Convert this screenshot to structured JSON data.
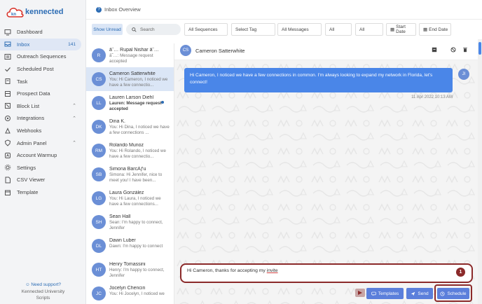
{
  "brand": {
    "name": "kennected",
    "logo_letters": "kn"
  },
  "sidebar": {
    "items": [
      {
        "label": "Dashboard",
        "icon": "monitor-icon"
      },
      {
        "label": "Inbox",
        "icon": "inbox-icon",
        "badge": "141",
        "active": true
      },
      {
        "label": "Outreach Sequences",
        "icon": "sequence-icon"
      },
      {
        "label": "Scheduled Post",
        "icon": "check-icon"
      },
      {
        "label": "Task",
        "icon": "task-icon"
      },
      {
        "label": "Prospect Data",
        "icon": "data-icon"
      },
      {
        "label": "Block List",
        "icon": "block-icon",
        "expandable": true
      },
      {
        "label": "Integrations",
        "icon": "integrations-icon",
        "expandable": true
      },
      {
        "label": "Webhooks",
        "icon": "webhook-icon"
      },
      {
        "label": "Admin Panel",
        "icon": "shield-icon",
        "expandable": true
      },
      {
        "label": "Account Warmup",
        "icon": "warmup-icon"
      },
      {
        "label": "Settings",
        "icon": "gear-icon"
      },
      {
        "label": "CSV Viewer",
        "icon": "file-icon"
      },
      {
        "label": "Template",
        "icon": "template-icon"
      }
    ],
    "support": {
      "label": "Need support?",
      "sub1": "Kennected University",
      "sub2": "Scripts"
    }
  },
  "topbar": {
    "title": "Inbox Overview"
  },
  "filters": {
    "unread_label": "Show Unread",
    "search_placeholder": "Search",
    "sequences": "All Sequences",
    "tag": "Select Tag",
    "messages": "All Messages",
    "all1": "All",
    "all2": "All",
    "start_date": "Start Date",
    "end_date": "End Date"
  },
  "conversations": [
    {
      "initials": "R",
      "name": "â˜… Rupal Nishar â˜…",
      "preview_prefix": "",
      "preview": "â˜…: Message request accepted"
    },
    {
      "initials": "CS",
      "name": "Cameron Satterwhite",
      "preview_prefix": "",
      "preview": "You: Hi Cameron, I noticed we have a few connectio...",
      "active": true
    },
    {
      "initials": "LL",
      "name": "Lauren Larson Diehl",
      "preview_prefix": "Lauren: Message request accepted",
      "preview": "",
      "unread": true
    },
    {
      "initials": "DK",
      "name": "Dina K.",
      "preview_prefix": "",
      "preview": "You: Hi Dina, I noticed we have a few connections ..."
    },
    {
      "initials": "RM",
      "name": "Rolando Munoz",
      "preview_prefix": "",
      "preview": "You: Hi Rolando, I noticed we have a few connectio..."
    },
    {
      "initials": "SB",
      "name": "Simona BarcÃƒu",
      "preview_prefix": "",
      "preview": "Simona: Hi Jennifer, nice to meet you! I have been..."
    },
    {
      "initials": "LG",
      "name": "Laura González",
      "preview_prefix": "",
      "preview": "You: Hi Laura, I noticed we have a few connections..."
    },
    {
      "initials": "SH",
      "name": "Sean Hall",
      "preview_prefix": "",
      "preview": "Sean: I'm happy to connect, Jennifer"
    },
    {
      "initials": "DL",
      "name": "Dawn Luber",
      "preview_prefix": "",
      "preview": "Dawn: I'm happy to connect"
    },
    {
      "initials": "HT",
      "name": "Henry Tomassini",
      "preview_prefix": "",
      "preview": "Henry: I'm happy to connect, Jennifer"
    },
    {
      "initials": "JC",
      "name": "Jocelyn Chencin",
      "preview_prefix": "",
      "preview": "You: Hi Jocelyn, I noticed we"
    }
  ],
  "chat": {
    "contact_initials": "CS",
    "contact_name": "Cameron Satterwhite",
    "message": "Hi Cameron, I noticed we have a few connections in common. I'm always looking to expand my network in Florida, let's connect!",
    "sender_initials": "JI",
    "timestamp": "11 Apr 2022 10:13 AM",
    "compose_text_before": "Hi Cameron, thanks for accepting my ",
    "compose_text_marked": "invite",
    "marker": "1",
    "templates_label": "Templates",
    "send_label": "Send",
    "schedule_label": "Schedule"
  },
  "colors": {
    "accent": "#4a86e8",
    "brand": "#2c6cb4",
    "annotation": "#8b2a2a"
  }
}
